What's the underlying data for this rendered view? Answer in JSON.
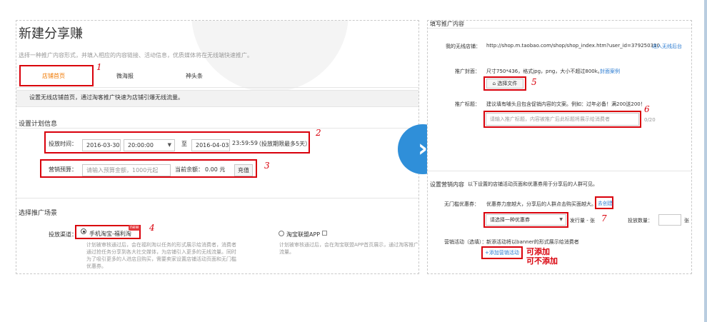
{
  "left": {
    "title": "新建分享赚",
    "subtitle": "选择一种推广内容形式，并填入相应的内容链接、活动信息，优质媒体将在无线端快速推广。",
    "tabs": [
      "店铺首页",
      "微海报",
      "神头条"
    ],
    "info_bar": "设置无线店铺首页，通过淘客推广快速为店铺引爆无线流量。",
    "plan_section": "设置计划信息",
    "time_label": "投放时间：",
    "start_date": "2016-03-30",
    "start_time": "20:00:00",
    "to": "至",
    "end_date": "2016-04-03",
    "end_time": "23:59:59",
    "time_note": "（投放期限最多5天）",
    "budget_label": "营销预算：",
    "budget_placeholder": "请输入预算金额，1000元起",
    "balance_label": "当前余额：",
    "balance_value": "0.00 元",
    "recharge": "充值",
    "scene_section": "选择推广场景",
    "channel_label": "投放渠道：",
    "channel1": "手机淘宝-福利淘",
    "new_badge": "new",
    "channel1_desc": [
      "计划被审核通过后，会在福利淘以任务的形式展示给消费者，消费者",
      "通过抢任务分享到各大社交媒体，为店铺引入更多的无线流量。同时",
      "为了吸引更多的人进店且购买，需要卖家设置店铺活动页面和无门槛",
      "优惠券。"
    ],
    "channel2": "淘宝联盟APP",
    "channel2_desc": [
      "计划被审核通过后，会在淘宝联盟APP首页展示，通过淘客推广",
      "流量。"
    ]
  },
  "right": {
    "fill_section": "填写推广内容",
    "shop_label": "我的无线店铺：",
    "shop_url": "http://shop.m.taobao.com/shop/shop_index.htm?user_id=379250310",
    "shop_link": "进入无线后台",
    "cover_label": "推广封面：",
    "cover_hint": "尺寸750*436，格式jpg，png，大小不超过800k。",
    "cover_link": "封面案例",
    "choose_file": "选择文件",
    "headline_label": "推广标题：",
    "headline_hint": "建议填有噱头且包含促销内容的文案。例如：过年必备！满200送200！",
    "headline_placeholder": "请输入推广标题，内容被推广后此标题将展示给消费者",
    "headline_count": "0/20",
    "marketing_section": "设置营销内容",
    "marketing_desc": "以下设置的店铺活动页面和优惠券用于分享后的人群可见。",
    "coupon_label": "无门槛优惠券：",
    "coupon_desc": "优惠券力度越大，分享后的人群点击购买面越大。",
    "coupon_create": "去创建",
    "coupon_select": "请选择一种优惠券",
    "issue_label": "发行量 - 张",
    "quantity_label": "投放数量：",
    "unit": "张",
    "activity_label": "营销活动（选填）：",
    "activity_desc": "新添活动将以banner的形式展示给消费者",
    "add_activity": "+添加营销活动",
    "note_add": "可添加",
    "note_no_add": "可不添加"
  },
  "annotations": [
    "1",
    "2",
    "3",
    "4",
    "5",
    "6",
    "7"
  ],
  "colors": {
    "accent": "#d9000b",
    "link": "#2b7bd1",
    "circle": "#2f8fd9",
    "tab_active": "#f07800"
  }
}
